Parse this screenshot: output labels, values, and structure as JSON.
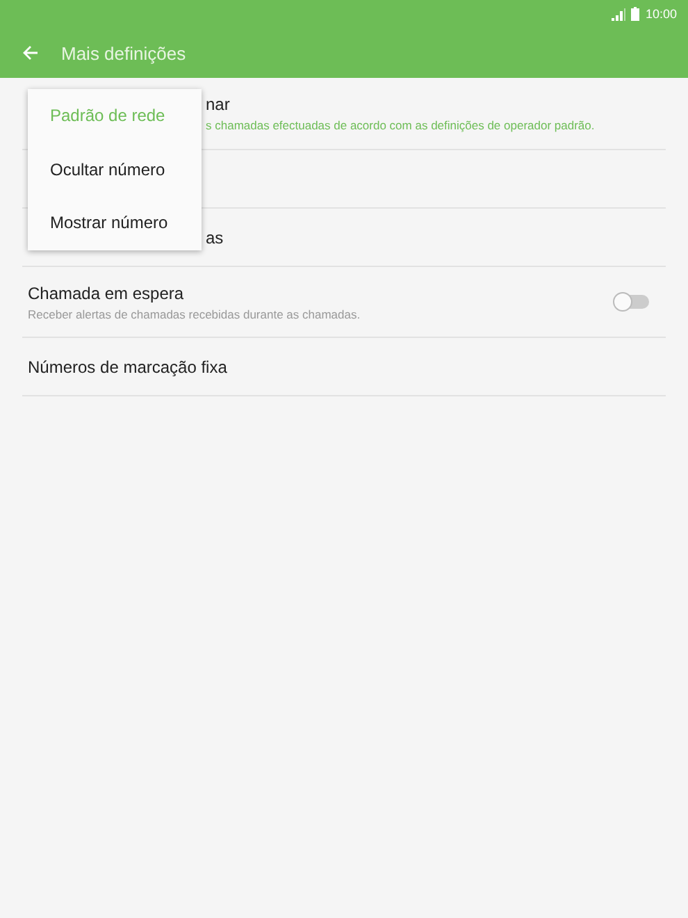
{
  "status_bar": {
    "time": "10:00"
  },
  "toolbar": {
    "title": "Mais definições"
  },
  "rows": [
    {
      "kind": "partial",
      "title": "nar",
      "subtitle": "s chamadas efectuadas de acordo com as definições de operador padrão."
    },
    {
      "kind": "hidden"
    },
    {
      "kind": "partial",
      "title": "as"
    },
    {
      "kind": "switch",
      "title": "Chamada em espera",
      "subtitle": "Receber alertas de chamadas recebidas durante as chamadas.",
      "on": false
    },
    {
      "kind": "plain",
      "title": "Números de marcação fixa"
    }
  ],
  "menu": [
    {
      "label": "Padrão de rede",
      "selected": true
    },
    {
      "label": "Ocultar número",
      "selected": false
    },
    {
      "label": "Mostrar número",
      "selected": false
    }
  ]
}
